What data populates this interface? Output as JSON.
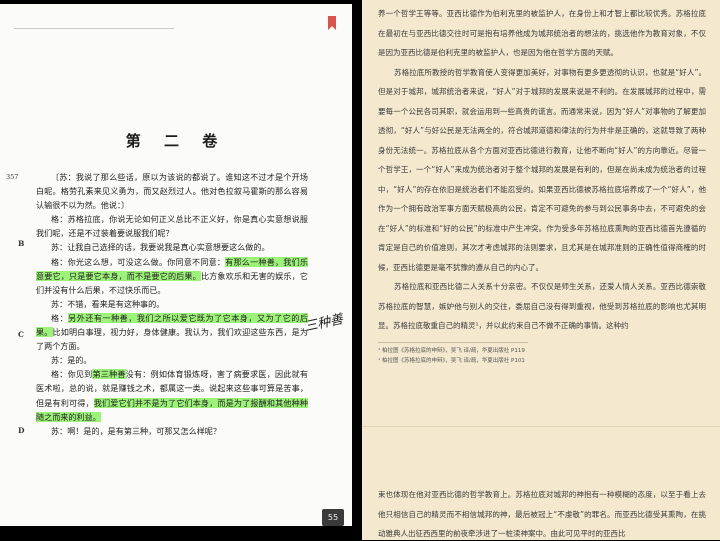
{
  "left_page": {
    "chapter_title": "第 二 卷",
    "margin_number": "357",
    "margin_letters": [
      "B",
      "C",
      "D"
    ],
    "handwriting": "三种善",
    "page_number": "55",
    "paragraphs": [
      [
        {
          "t": "〔苏：我说了那么些话，原以为该说的都说了。谁知这不过才是个开场白呢。格劳孔素来见义勇为，而又赵烈过人。他对色拉叙马霍斯的那么容易认输很不以为然。他说：〕"
        }
      ],
      [
        {
          "t": "格：苏格拉底，你说无论如何正义总比不正义好，你是真心实意想说服我们呢，还是不过装着要说服我们呢？"
        }
      ],
      [
        {
          "t": "苏：让我自己选择的话，我要说我是真心实意想要这么做的。"
        }
      ],
      [
        {
          "t": "格：你光这么想，可没这么做。你同意不同意："
        },
        {
          "t": "有那么一种善，我们乐意要它，只是要它本身，而不是要它的后果。",
          "hl": true
        },
        {
          "t": "比方象欢乐和无害的娱乐，它们并没有什么后果，不过快乐而已。"
        }
      ],
      [
        {
          "t": "苏：不错，看来是有这种事的。"
        }
      ],
      [
        {
          "t": "格："
        },
        {
          "t": "另外还有一种善，我们之所以爱它既为了它本身，又为了它的后果。",
          "hl": true
        },
        {
          "t": "比如明白事理，视力好，身体健康。我认为，我们欢迎这些东西，是为了两个方面。"
        }
      ],
      [
        {
          "t": "苏：是的。"
        }
      ],
      [
        {
          "t": "格：你见到"
        },
        {
          "t": "第三种善",
          "hl": true
        },
        {
          "t": "没有：例如体育锻炼呀，害了病要求医，因此就有医术啦，总的说，就是赚钱之术，都属这一类。说起来这些事可算是苦事，但是有利可得，"
        },
        {
          "t": "我们爱它们并不是为了它们本身，而是为了报酬和其他种种随之而来的利益。",
          "hl": true
        }
      ],
      [
        {
          "t": "苏：啊！是的，是有第三种，可那又怎么样呢？"
        }
      ]
    ]
  },
  "right_page": {
    "paragraphs": [
      {
        "cont": true,
        "t": "养一个哲学王等等。亚西比德作为伯利克里的被监护人，在身份上和才智上都比较优秀。苏格拉底在最初在与亚西比德交往时可是抱有培养他成为城邦统治者的想法的，挑选他作为教育对象，不仅是因为亚西比德是伯利克里的被监护人，也是因为他在哲学方面的天赋。"
      },
      {
        "t": "苏格拉底所教授的哲学教育使人变得更加美好，对事物有更多更透彻的认识，也就是“好人”。但是对于城邦，城邦统治者来说，“好人”对于城邦的发展来说是不利的。在发展城邦的过程中，需要每一个公民各司其职，就会运用到一些高贵的谎言。而通常来说，因为“好人”对事物的了解更加透彻，“好人”与好公民是无法两全的，符合城邦道德和律法的行为并非是正确的，这就导致了两种身份无法统一。苏格拉底从各个方面对亚西比德进行教育，让他不断向“好人”的方向靠近。尽管一个哲学王，一个“好人”来成为统治者对于整个城邦的发展是有利的，但是在尚未成为统治者的过程中，“好人”的存在依旧是统治者们不能忍受的。如果亚西比德被苏格拉底培养成了一个“好人”，他作为一个拥有政治军事方面天赋极高的公民，肯定不可避免的参与到公民事务中去，不可避免的会在“好人”的标准和“好的公民”的标准中产生冲突。作为受多年苏格拉底熏陶的亚西比德首先遵循的肯定是自己的价值准则，其次才考虑城邦的法则要求，且尤其是在城邦准则的正确性值得商榷的时候，亚西比德更是毫不犹豫的遵从自己的内心了。"
      },
      {
        "t": "苏格拉底和亚西比德二人关系十分亲密。不仅仅是师生关系，还爱人情人关系。亚西比德崇敬苏格拉底的智慧，嫉妒他与别人的交往，委屈自己没有得到重视，他受到苏格拉底的影响也尤其明显。苏格拉底敬重自己的精灵¹，并以此约束自己不做不正确的事情。这种约"
      }
    ],
    "footnotes": [
      "¹ 柏拉图《苏格拉底的申辩》，吴飞 译/疏，华夏出版社 P119",
      "¹ 柏拉图《苏格拉底的申辩》，吴飞 译/疏，华夏出版社 P101"
    ],
    "bottom_paragraphs": [
      {
        "cont": true,
        "t": "束也体现在他对亚西比德的哲学教育上。苏格拉底对城邦的神抱有一种模糊的态度，以至于看上去他只相信自己的精灵而不相信城邦的神，最后被冠上“不虔敬”的罪名。而亚西比德受其熏陶，在挑动雅典人出征西西里的前夜牵涉进了一桩渎神案中。由此可见平时的亚西比"
      }
    ]
  }
}
